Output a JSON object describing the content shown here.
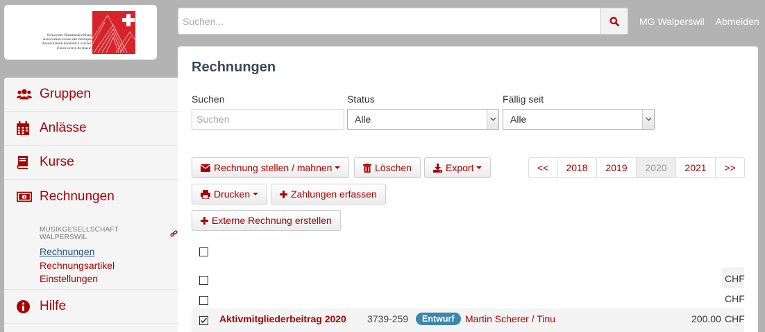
{
  "logo": {
    "lines": [
      "Schweizer Blasmusikverband",
      "Association suisse des musiques",
      "Associazione bandistica svizzera",
      "Uniun svizra da musica"
    ]
  },
  "search": {
    "placeholder": "Suchen..."
  },
  "top_links": {
    "group": "MG Walperswil",
    "logout": "Abmeiden"
  },
  "sidebar": {
    "items": [
      {
        "label": "Gruppen",
        "icon": "users-icon"
      },
      {
        "label": "Anlässe",
        "icon": "calendar-icon"
      },
      {
        "label": "Kurse",
        "icon": "book-icon"
      },
      {
        "label": "Rechnungen",
        "icon": "money-icon"
      },
      {
        "label": "Hilfe",
        "icon": "info-icon"
      }
    ],
    "subnav": {
      "group": "Musikgesellschaft Walperswil",
      "links": [
        "Rechnungen",
        "Rechnungsartikel",
        "Einstellungen"
      ]
    }
  },
  "main": {
    "title": "Rechnungen",
    "filters": {
      "search_label": "Suchen",
      "search_placeholder": "Suchen",
      "status_label": "Status",
      "status_value": "Alle",
      "due_label": "Fällig seit",
      "due_value": "Alle"
    },
    "buttons": {
      "create": "Rechnung stellen / mahnen",
      "delete": "Löschen",
      "export": "Export",
      "print": "Drucken",
      "payments": "Zahlungen erfassen",
      "external": "Externe Rechnung erstellen"
    },
    "pager": [
      "<<",
      "2018",
      "2019",
      "2020",
      "2021",
      ">>"
    ],
    "pager_active": "2020",
    "table": {
      "rows": [
        {
          "currency": "CHF",
          "checked": false
        },
        {
          "currency": "CHF",
          "checked": false
        },
        {
          "title": "Aktivmitgliederbeitrag 2020",
          "number": "3739-259",
          "state": "Entwurf",
          "recipient": "Martin Scherer / Tinu",
          "amount": "200.00",
          "currency": "CHF",
          "checked": true
        }
      ]
    }
  },
  "colors": {
    "accent": "#aa0000",
    "badge": "#3a87ad",
    "title": "#3d4a55"
  }
}
